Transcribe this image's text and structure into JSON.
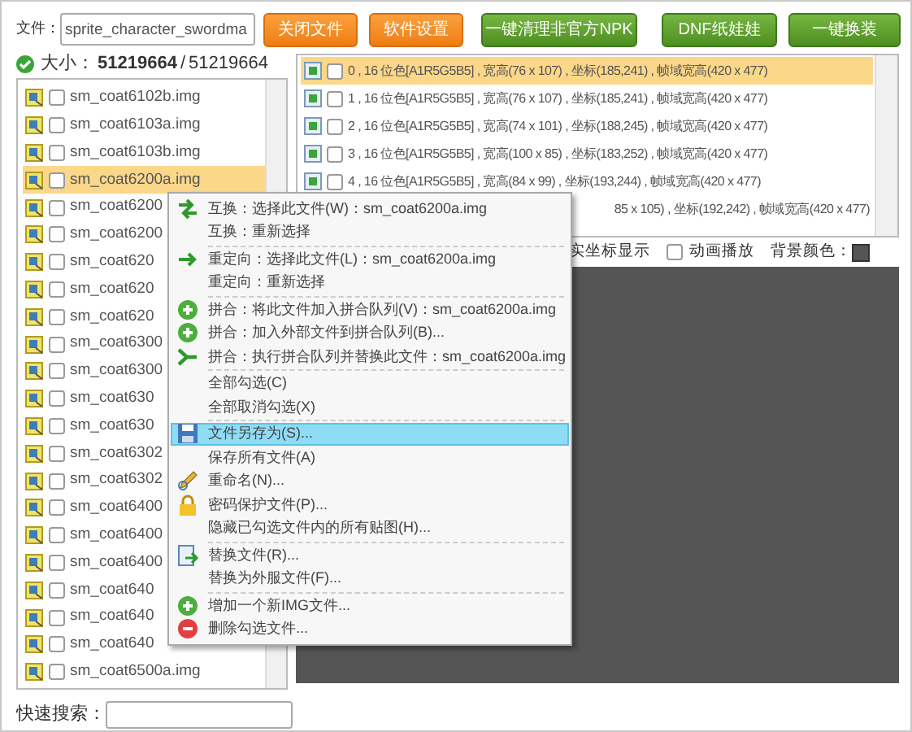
{
  "toolbar": {
    "file_label": "文件：",
    "file_value": "sprite_character_swordma",
    "buttons": [
      {
        "label": "关闭文件",
        "kind": "orange"
      },
      {
        "label": "软件设置",
        "kind": "orange"
      },
      {
        "label": "一键清理非官方NPK",
        "kind": "green"
      },
      {
        "label": "DNF纸娃娃",
        "kind": "green"
      },
      {
        "label": "一键换装",
        "kind": "green"
      }
    ]
  },
  "size": {
    "label": "大小：",
    "value": "51219664",
    "separator": "/",
    "total": "51219664"
  },
  "file_list": [
    {
      "name": "sm_coat6102b.img",
      "checked": false,
      "selected": false
    },
    {
      "name": "sm_coat6103a.img",
      "checked": false,
      "selected": false
    },
    {
      "name": "sm_coat6103b.img",
      "checked": false,
      "selected": false
    },
    {
      "name": "sm_coat6200a.img",
      "checked": false,
      "selected": true
    },
    {
      "name": "sm_coat6200",
      "checked": false,
      "selected": false
    },
    {
      "name": "sm_coat6200",
      "checked": false,
      "selected": false
    },
    {
      "name": "sm_coat620",
      "checked": false,
      "selected": false
    },
    {
      "name": "sm_coat620",
      "checked": false,
      "selected": false
    },
    {
      "name": "sm_coat620",
      "checked": false,
      "selected": false
    },
    {
      "name": "sm_coat6300",
      "checked": false,
      "selected": false
    },
    {
      "name": "sm_coat6300",
      "checked": false,
      "selected": false
    },
    {
      "name": "sm_coat630",
      "checked": false,
      "selected": false
    },
    {
      "name": "sm_coat630",
      "checked": false,
      "selected": false
    },
    {
      "name": "sm_coat6302",
      "checked": false,
      "selected": false
    },
    {
      "name": "sm_coat6302",
      "checked": false,
      "selected": false
    },
    {
      "name": "sm_coat6400",
      "checked": false,
      "selected": false
    },
    {
      "name": "sm_coat6400",
      "checked": false,
      "selected": false
    },
    {
      "name": "sm_coat6400",
      "checked": false,
      "selected": false
    },
    {
      "name": "sm_coat640",
      "checked": false,
      "selected": false
    },
    {
      "name": "sm_coat640",
      "checked": false,
      "selected": false
    },
    {
      "name": "sm_coat640",
      "checked": false,
      "selected": false
    },
    {
      "name": "sm_coat6500a.img",
      "checked": false,
      "selected": false
    }
  ],
  "quick_search": {
    "label": "快速搜索："
  },
  "frame_list": [
    {
      "text": "0 , 16 位色[A1R5G5B5] , 宽高(76 x 107) , 坐标(185,241) , 帧域宽高(420 x 477)",
      "checked": false,
      "selected": true
    },
    {
      "text": "1 , 16 位色[A1R5G5B5] , 宽高(76 x 107) , 坐标(185,241) , 帧域宽高(420 x 477)",
      "checked": false,
      "selected": false
    },
    {
      "text": "2 , 16 位色[A1R5G5B5] , 宽高(74 x 101) , 坐标(188,245) , 帧域宽高(420 x 477)",
      "checked": false,
      "selected": false
    },
    {
      "text": "3 , 16 位色[A1R5G5B5] , 宽高(100 x 85) , 坐标(183,252) , 帧域宽高(420 x 477)",
      "checked": false,
      "selected": false
    },
    {
      "text": "4 , 16 位色[A1R5G5B5] , 宽高(84 x 99) , 坐标(193,244) , 帧域宽高(420 x 477)",
      "checked": false,
      "selected": false
    },
    {
      "text": "85 x 105) , 坐标(192,242) , 帧域宽高(420 x 477)",
      "selected": false
    }
  ],
  "options": {
    "coord_label": "实坐标显示",
    "animation": {
      "label": "动画播放",
      "checked": false
    },
    "bg_label": "背景颜色："
  },
  "context_menu": [
    [
      {
        "label": "互换：选择此文件(W)：sm_coat6200a.img",
        "selected": false
      },
      {
        "label": "互换：重新选择",
        "selected": false
      }
    ],
    [
      {
        "label": "重定向：选择此文件(L)：sm_coat6200a.img",
        "selected": false
      },
      {
        "label": "重定向：重新选择",
        "selected": false
      }
    ],
    [
      {
        "label": "拼合：将此文件加入拼合队列(V)：sm_coat6200a.img",
        "selected": false
      },
      {
        "label": "拼合：加入外部文件到拼合队列(B)...",
        "selected": false
      },
      {
        "label": "拼合：执行拼合队列并替换此文件：sm_coat6200a.img",
        "selected": false
      }
    ],
    [
      {
        "label": "全部勾选(C)",
        "selected": false
      },
      {
        "label": "全部取消勾选(X)",
        "selected": false
      }
    ],
    [
      {
        "label": "文件另存为(S)...",
        "selected": true
      },
      {
        "label": "保存所有文件(A)",
        "selected": false
      },
      {
        "label": "重命名(N)...",
        "selected": false
      },
      {
        "label": "密码保护文件(P)...",
        "selected": false
      },
      {
        "label": "隐藏已勾选文件内的所有贴图(H)...",
        "selected": false
      }
    ],
    [
      {
        "label": "替换文件(R)...",
        "selected": false
      },
      {
        "label": "替换为外服文件(F)...",
        "selected": false
      }
    ],
    [
      {
        "label": "增加一个新IMG文件...",
        "selected": false
      },
      {
        "label": "删除勾选文件...",
        "selected": false
      }
    ]
  ]
}
